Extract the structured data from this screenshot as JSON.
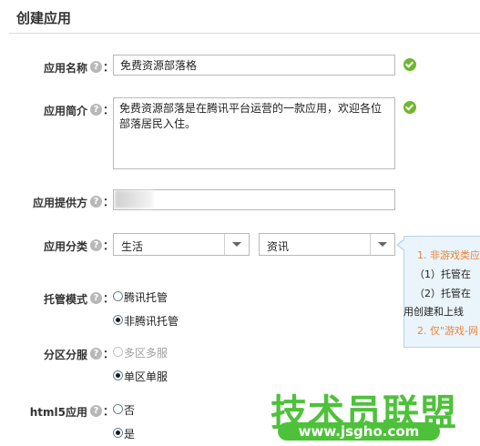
{
  "header": {
    "title": "创建应用"
  },
  "form": {
    "name": {
      "label": "应用名称",
      "value": "免费资源部落格"
    },
    "intro": {
      "label": "应用简介",
      "value": "免费资源部落是在腾讯平台运营的一款应用，欢迎各位部落居民入住。"
    },
    "provider": {
      "label": "应用提供方",
      "value": ""
    },
    "category": {
      "label": "应用分类",
      "primary": "生活",
      "secondary": "资讯"
    },
    "hosting": {
      "label": "托管模式",
      "options": [
        "腾讯托管",
        "非腾讯托管"
      ],
      "selected": "非腾讯托管"
    },
    "partition": {
      "label": "分区分服",
      "options": [
        "多区多服",
        "单区单服"
      ],
      "selected": "单区单服",
      "disabled_option": "多区多服"
    },
    "html5": {
      "label": "html5应用",
      "options": [
        "否",
        "是"
      ],
      "selected": "是"
    },
    "help_glyph": "?",
    "colon": "："
  },
  "tooltip": {
    "lines": [
      "1. 非游戏类应",
      "（1）托管在",
      "（2）托管在",
      "用创建和上线",
      "2. 仅\"游戏-网"
    ]
  },
  "watermark": {
    "text": "技术员联盟",
    "url": "www.jsgho.com"
  },
  "colors": {
    "accent_green": "#6fb62f",
    "tip_orange": "#e8843a",
    "tip_bg": "#eaf4fb",
    "watermark_green": "#4ec13a"
  }
}
